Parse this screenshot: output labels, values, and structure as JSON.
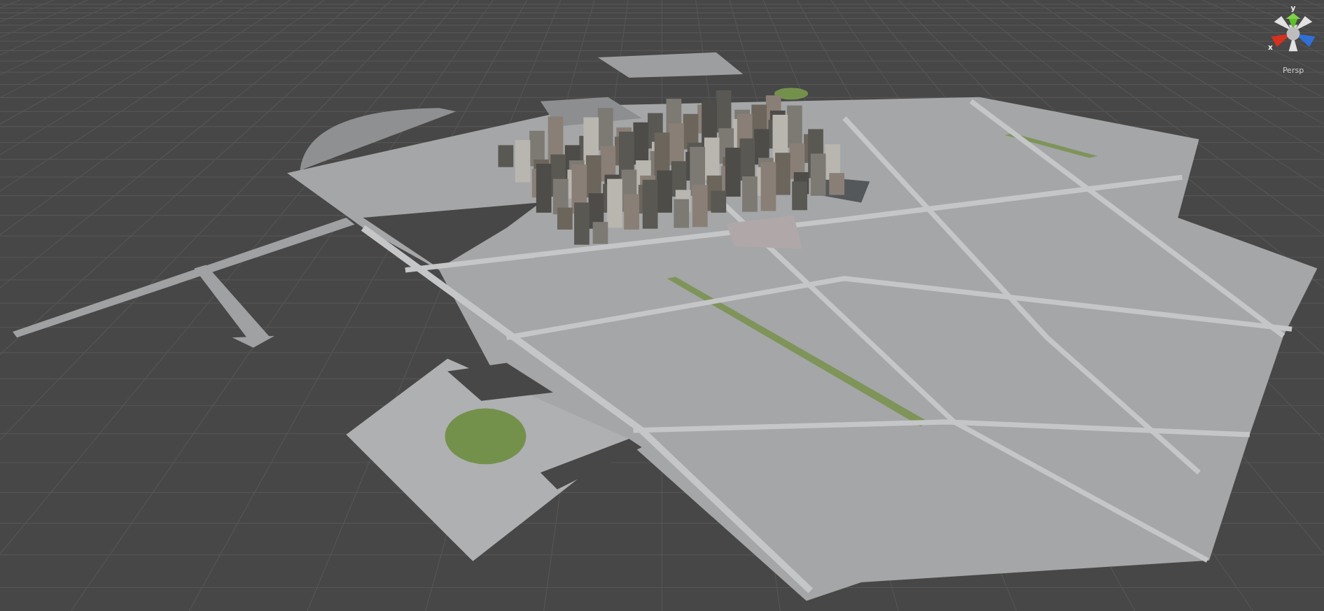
{
  "scene_view": {
    "gizmo": {
      "y_label": "y",
      "x_label": "x"
    },
    "projection_label": "Persp"
  }
}
